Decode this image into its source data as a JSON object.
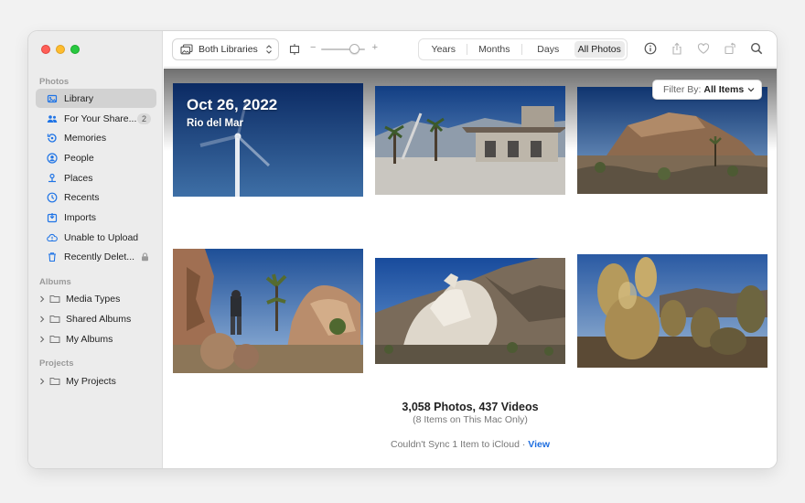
{
  "sidebar": {
    "section_photos": "Photos",
    "section_albums": "Albums",
    "section_projects": "Projects",
    "items": [
      {
        "label": "Library",
        "icon": "library-icon"
      },
      {
        "label": "For Your Share...",
        "icon": "shared-people-icon",
        "badge": "2"
      },
      {
        "label": "Memories",
        "icon": "memories-icon"
      },
      {
        "label": "People",
        "icon": "person-icon"
      },
      {
        "label": "Places",
        "icon": "pin-icon"
      },
      {
        "label": "Recents",
        "icon": "clock-icon"
      },
      {
        "label": "Imports",
        "icon": "import-icon"
      },
      {
        "label": "Unable to Upload",
        "icon": "cloud-alert-icon"
      },
      {
        "label": "Recently Delet...",
        "icon": "trash-icon"
      }
    ],
    "albums": [
      "Media Types",
      "Shared Albums",
      "My Albums"
    ],
    "projects": [
      "My Projects"
    ]
  },
  "toolbar": {
    "library_select": "Both Libraries",
    "slider_minus": "−",
    "slider_plus": "+",
    "slider_value": 0.75,
    "views": [
      "Years",
      "Months",
      "Days",
      "All Photos"
    ],
    "selected_view": "All Photos"
  },
  "content": {
    "date": "Oct 26, 2022",
    "place": "Rio del Mar",
    "filter_label": "Filter By:",
    "filter_value": "All Items",
    "counts": "3,058 Photos, 437 Videos",
    "sub_note": "(8 Items on This Mac Only)",
    "sync_text": "Couldn't Sync 1 Item to iCloud ·",
    "sync_link": "View"
  },
  "colors": {
    "accent": "#1f74e6",
    "sidebar_bg": "#ececec",
    "selected_bg": "#d2d2d2"
  }
}
